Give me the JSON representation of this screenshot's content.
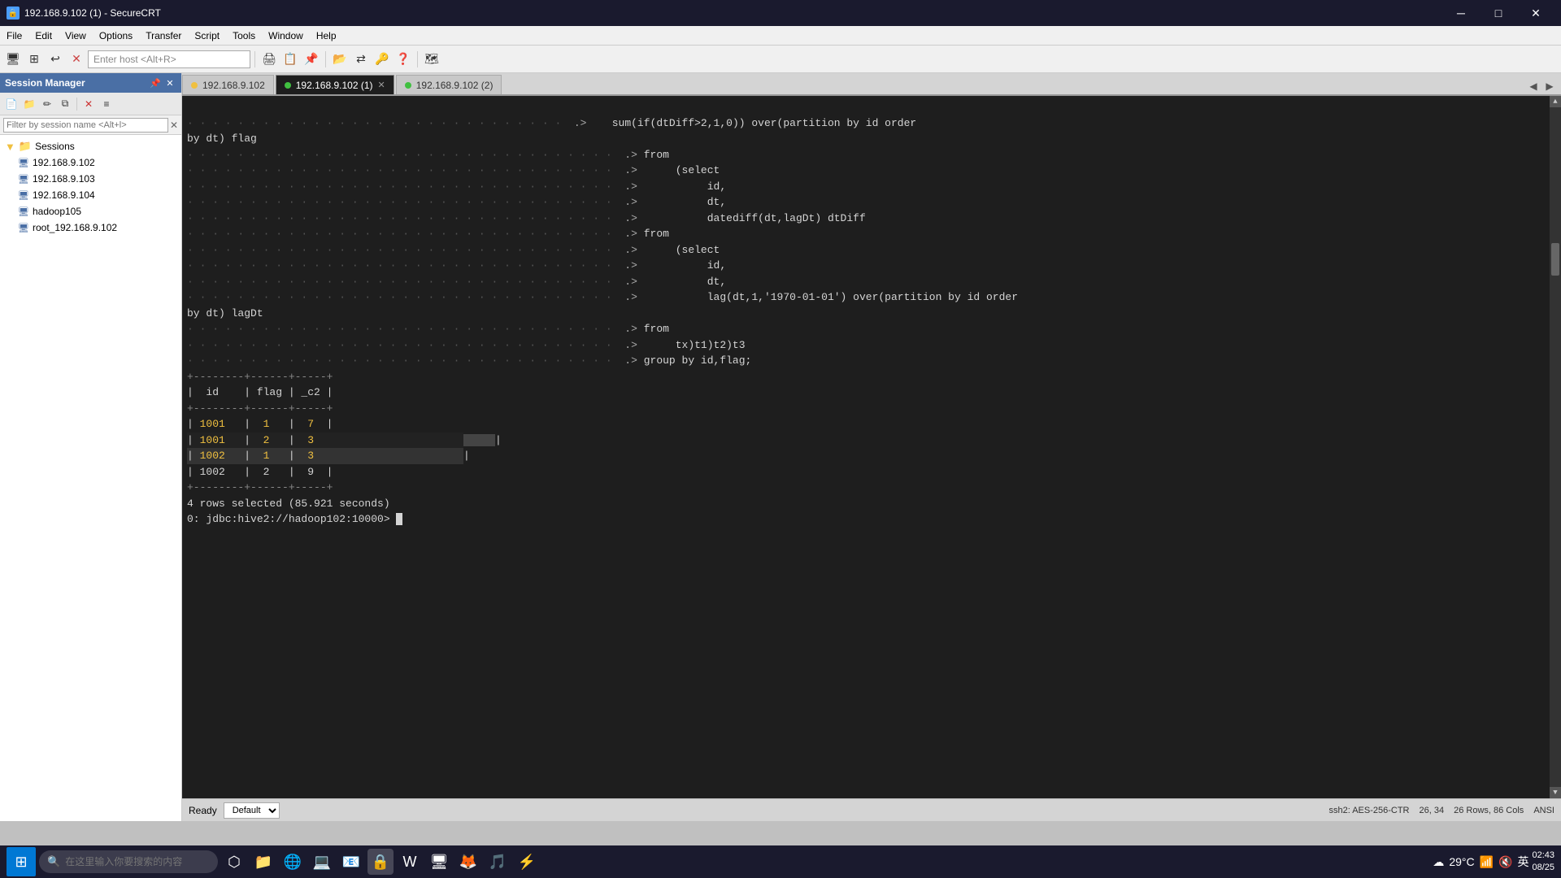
{
  "titleBar": {
    "title": "192.168.9.102 (1) - SecureCRT",
    "icon": "🔒",
    "controls": [
      "─",
      "□",
      "✕"
    ]
  },
  "menuBar": {
    "items": [
      "File",
      "Edit",
      "View",
      "Options",
      "Transfer",
      "Script",
      "Tools",
      "Window",
      "Help"
    ]
  },
  "toolbar": {
    "addressPlaceholder": "Enter host <Alt+R>"
  },
  "sessionPanel": {
    "title": "Session Manager",
    "filterPlaceholder": "Filter by session name <Alt+l>",
    "sessions": {
      "rootLabel": "Sessions",
      "items": [
        {
          "label": "192.168.9.102",
          "type": "server"
        },
        {
          "label": "192.168.9.103",
          "type": "server"
        },
        {
          "label": "192.168.9.104",
          "type": "server"
        },
        {
          "label": "hadoop105",
          "type": "server"
        },
        {
          "label": "root_192.168.9.102",
          "type": "server"
        }
      ]
    }
  },
  "tabs": [
    {
      "label": "192.168.9.102",
      "dotColor": "yellow",
      "active": false,
      "closeable": false
    },
    {
      "label": "192.168.9.102 (1)",
      "dotColor": "green",
      "active": true,
      "closeable": true
    },
    {
      "label": "192.168.9.102 (2)",
      "dotColor": "green",
      "active": false,
      "closeable": false
    }
  ],
  "terminal": {
    "lines": [
      {
        "type": "dots-code",
        "dots": "· · · · · · · · · · · · · · · · · · · ·",
        "arrow": ".>",
        "code": "    sum(if(dtDiff>2,1,0)) over(partition by id order"
      },
      {
        "type": "text",
        "content": "by dt) flag"
      },
      {
        "type": "dots-code",
        "dots": "· · · · · · · · · · · · · · · · · · · · · · · · · ·",
        "arrow": ".>",
        "code": " from"
      },
      {
        "type": "dots-code",
        "dots": "· · · · · · · · · · · · · · · · · · · · · · · · · ·",
        "arrow": ".>",
        "code": "     (select"
      },
      {
        "type": "dots-code",
        "dots": "· · · · · · · · · · · · · · · · · · · · · · · · · ·",
        "arrow": ".>",
        "code": "          id,"
      },
      {
        "type": "dots-code",
        "dots": "· · · · · · · · · · · · · · · · · · · · · · · · · ·",
        "arrow": ".>",
        "code": "          dt,"
      },
      {
        "type": "dots-code",
        "dots": "· · · · · · · · · · · · · · · · · · · · · · · · · ·",
        "arrow": ".>",
        "code": "          datediff(dt,lagDt) dtDiff"
      },
      {
        "type": "dots-code",
        "dots": "· · · · · · · · · · · · · · · · · · · · · · · · · ·",
        "arrow": ".>",
        "code": " from"
      },
      {
        "type": "dots-code",
        "dots": "· · · · · · · · · · · · · · · · · · · · · · · · · ·",
        "arrow": ".>",
        "code": "     (select"
      },
      {
        "type": "dots-code",
        "dots": "· · · · · · · · · · · · · · · · · · · · · · · · · ·",
        "arrow": ".>",
        "code": "          id,"
      },
      {
        "type": "dots-code",
        "dots": "· · · · · · · · · · · · · · · · · · · · · · · · · ·",
        "arrow": ".>",
        "code": "          dt,"
      },
      {
        "type": "dots-code",
        "dots": "· · · · · · · · · · · · · · · · · · · · · · · · · ·",
        "arrow": ".>",
        "code": "          lag(dt,1,'1970-01-01') over(partition by id order"
      },
      {
        "type": "text",
        "content": "by dt) lagDt"
      },
      {
        "type": "dots-code",
        "dots": "· · · · · · · · · · · · · · · · · · · · · · · · · ·",
        "arrow": ".>",
        "code": " from"
      },
      {
        "type": "dots-code",
        "dots": "· · · · · · · · · · · · · · · · · · · · · · · · · ·",
        "arrow": ".>",
        "code": "     tx)t1)t2)t3"
      },
      {
        "type": "dots-code",
        "dots": "· · · · · · · · · · · · · · · · · · · · · · · · · ·",
        "arrow": ".>",
        "code": " group by id,flag;"
      },
      {
        "type": "table-separator"
      },
      {
        "type": "table-header",
        "cols": [
          "id",
          "flag",
          "_c2"
        ]
      },
      {
        "type": "table-separator"
      },
      {
        "type": "table-row-normal",
        "cols": [
          "1001",
          "1",
          "7"
        ],
        "highlight": false
      },
      {
        "type": "table-row-selected",
        "cols": [
          "1001",
          "2",
          "3"
        ],
        "highlight": true
      },
      {
        "type": "table-row-selected2",
        "cols": [
          "1002",
          "1",
          "3"
        ],
        "highlight": true
      },
      {
        "type": "table-row-normal",
        "cols": [
          "1002",
          "2",
          "9"
        ],
        "highlight": false
      },
      {
        "type": "table-separator"
      },
      {
        "type": "text-plain",
        "content": "4 rows selected (85.921 seconds)"
      },
      {
        "type": "prompt",
        "content": "0: jdbc:hive2://hadoop102:10000> "
      }
    ]
  },
  "statusBar": {
    "ready": "Ready",
    "dropdown": "Default",
    "ssh": "ssh2: AES-256-CTR",
    "position": "26, 34",
    "size": "26 Rows, 86 Cols",
    "encoding": "ANSI"
  },
  "taskbar": {
    "searchPlaceholder": "在这里输入你要搜索的内容",
    "time": "08/25",
    "temperature": "29°C",
    "language": "英",
    "icons": [
      "⊞",
      "🔍",
      "⬡",
      "⬜",
      "📁",
      "🌐",
      "💻",
      "📧",
      "🔑",
      "W",
      "🖥",
      "🦊",
      "🎵",
      "⚡"
    ]
  }
}
